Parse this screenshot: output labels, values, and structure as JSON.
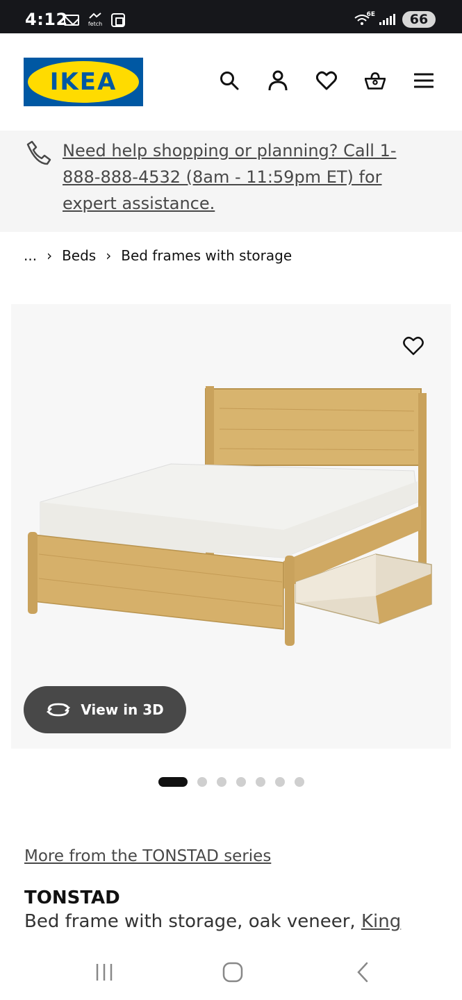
{
  "status_bar": {
    "time": "4:12",
    "fetch_label": "fetch",
    "wifi_label": "6E",
    "battery": "66"
  },
  "header": {
    "logo_text": "IKEA",
    "icons": [
      "search-icon",
      "account-icon",
      "favorites-icon",
      "basket-icon",
      "menu-icon"
    ]
  },
  "help_banner": {
    "text": "Need help shopping or planning? Call 1-888-888-4532 (8am - 11:59pm ET) for expert assistance."
  },
  "breadcrumb": {
    "items": [
      "...",
      "Beds",
      "Bed frames with storage"
    ]
  },
  "media": {
    "view3d_label": "View in 3D",
    "slide_count": 7,
    "active_slide": 1
  },
  "product": {
    "series_link": "More from the TONSTAD series",
    "name": "TONSTAD",
    "description": "Bed frame with storage, oak veneer, ",
    "size_link": "King"
  },
  "colors": {
    "ikea_blue": "#0058a3",
    "ikea_yellow": "#ffdb00",
    "dark_button": "#484848"
  }
}
